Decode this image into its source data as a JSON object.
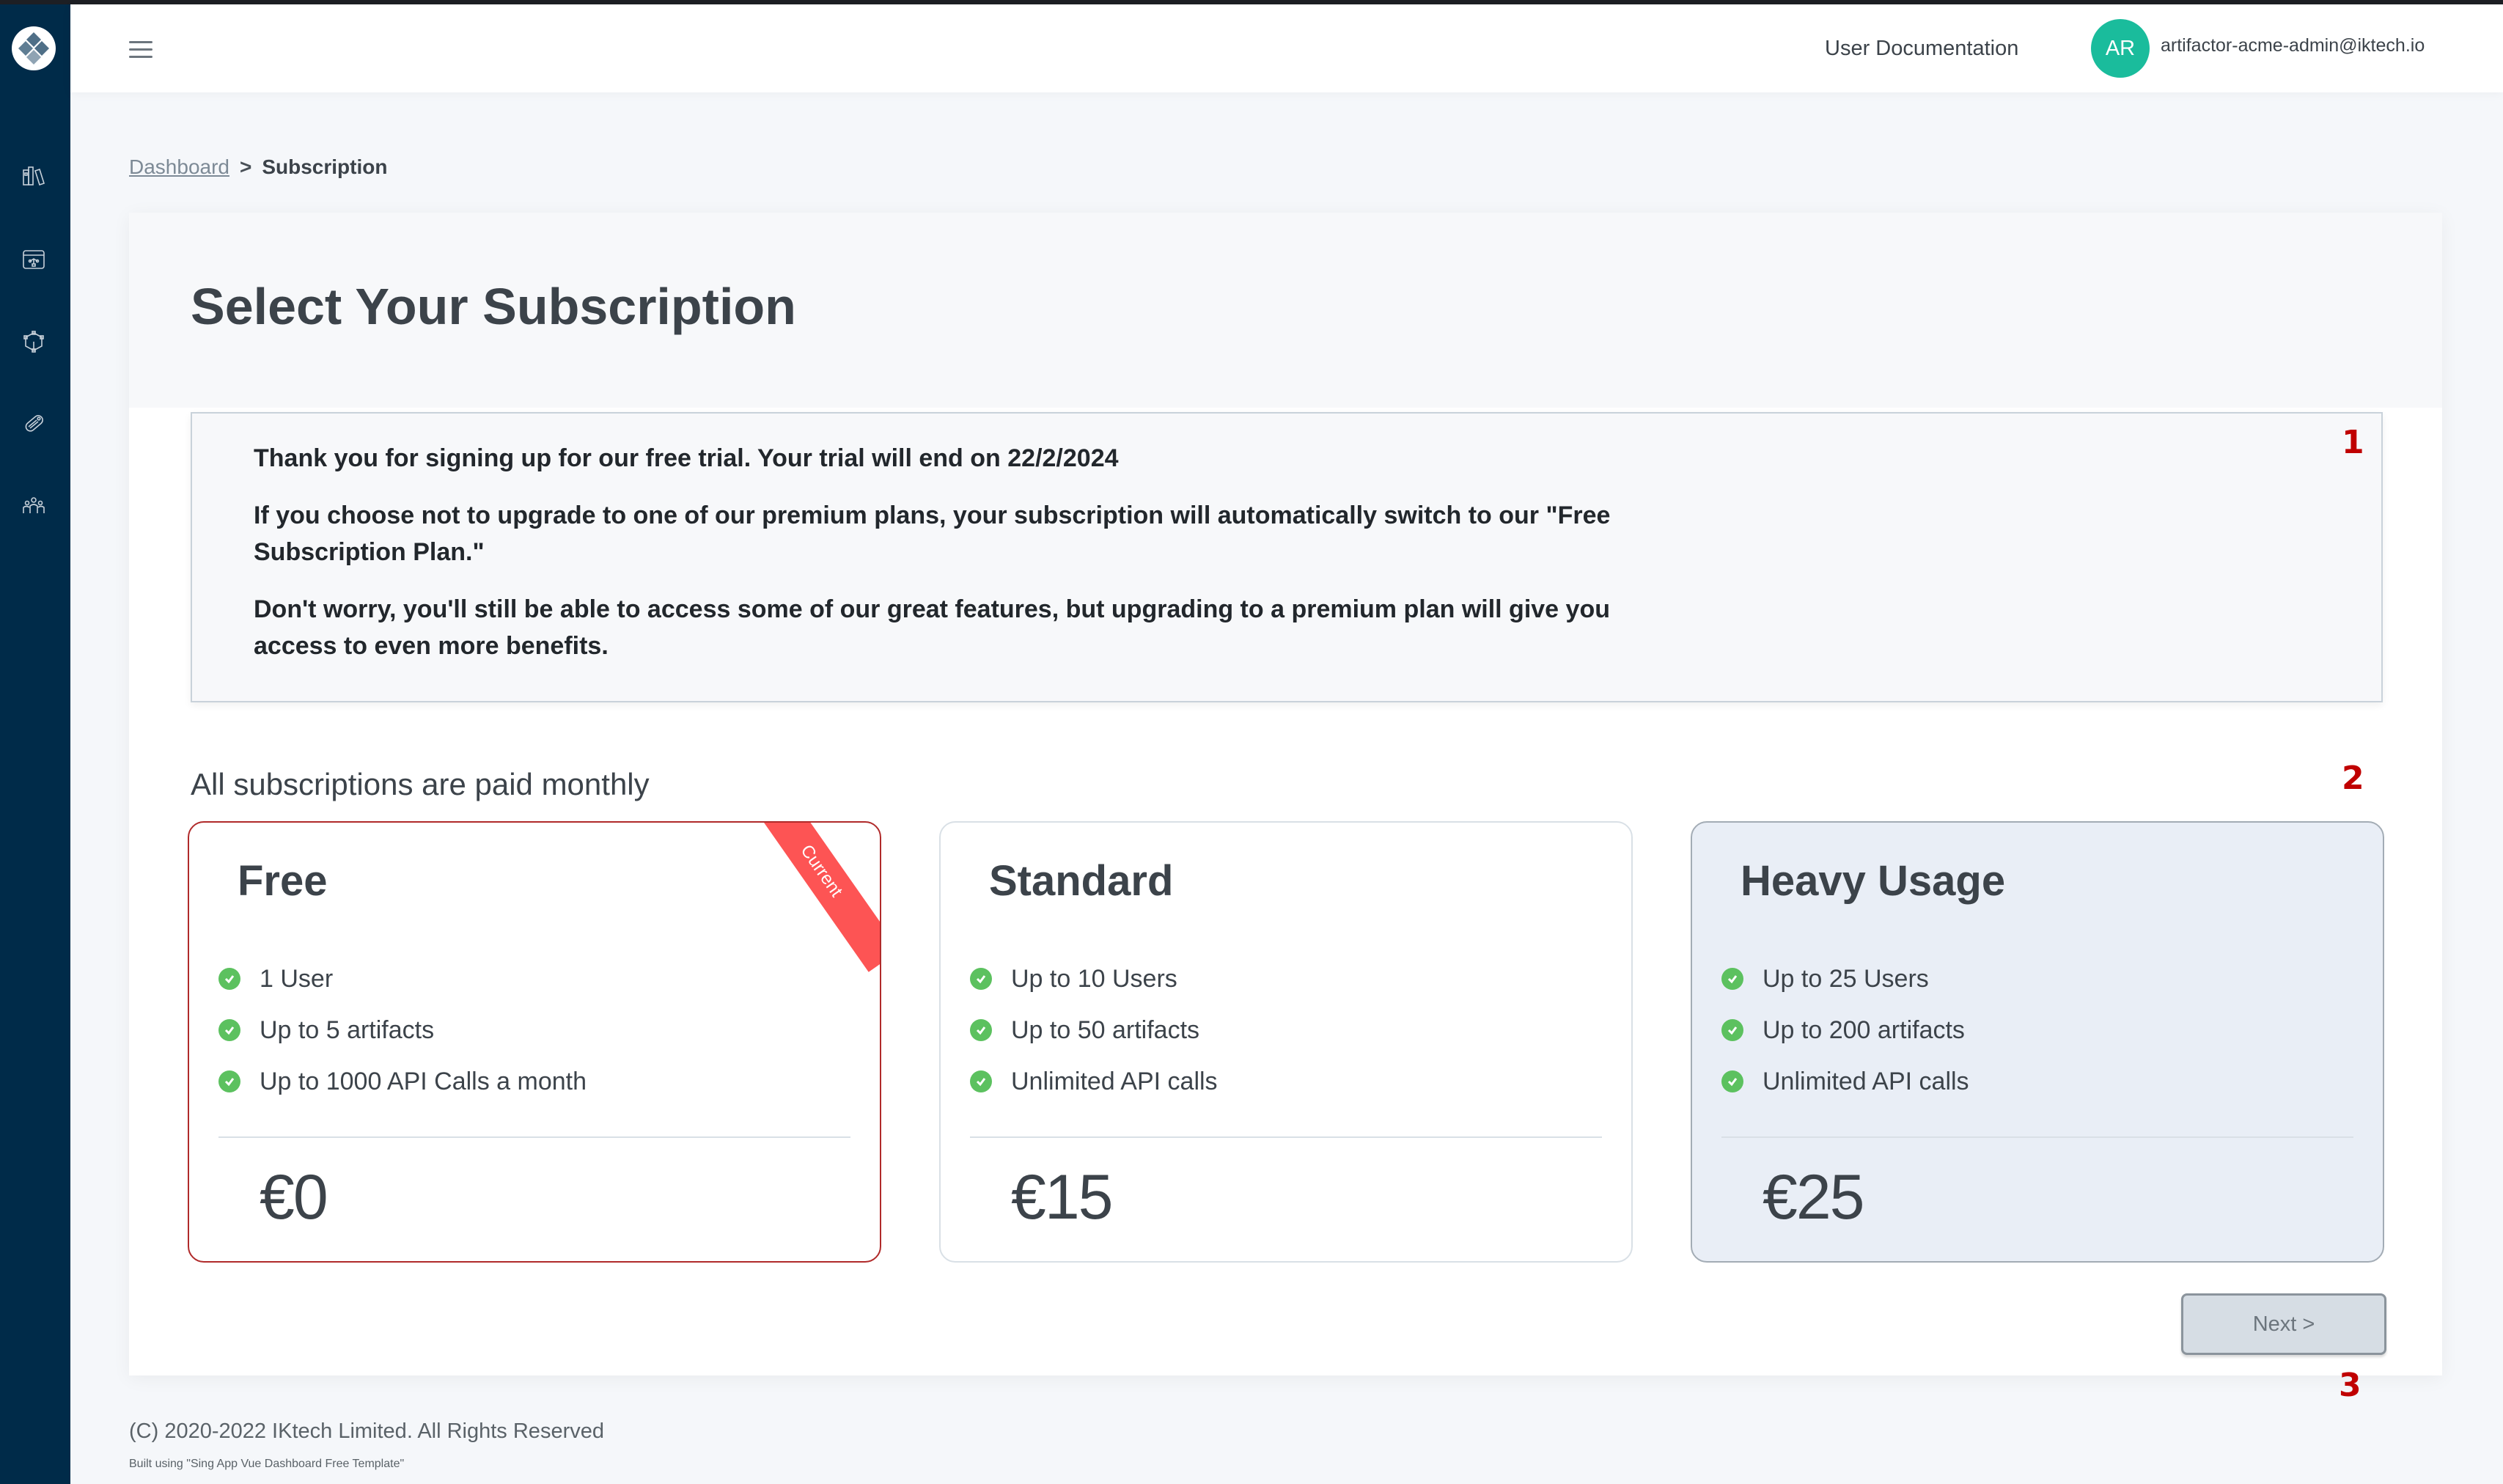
{
  "app": {
    "logo": "diamond-logo",
    "sidebar_items": [
      {
        "name": "library",
        "icon": "books-icon"
      },
      {
        "name": "workflows",
        "icon": "browser-flow-icon"
      },
      {
        "name": "models",
        "icon": "network-cube-icon"
      },
      {
        "name": "tags",
        "icon": "tag-icon"
      },
      {
        "name": "team",
        "icon": "users-icon"
      }
    ]
  },
  "header": {
    "menu_icon": "hamburger-icon",
    "docs_link": "User Documentation",
    "avatar_initials": "AR",
    "user_email": "artifactor-acme-admin@iktech.io"
  },
  "breadcrumb": {
    "parent": "Dashboard",
    "separator": ">",
    "current": "Subscription"
  },
  "page": {
    "title": "Select Your Subscription",
    "notice": [
      "Thank you for signing up for our free trial. Your trial will end on 22/2/2024",
      "If you choose not to upgrade to one of our premium plans, your subscription will automatically switch to our \"Free Subscription Plan.\"",
      "Don't worry, you'll still be able to access some of our great features, but upgrading to a premium plan will give you access to even more benefits."
    ],
    "paid_note": "All subscriptions are paid monthly",
    "plans": [
      {
        "name": "Free",
        "ribbon": "Current",
        "features": [
          "1 User",
          "Up to 5 artifacts",
          "Up to 1000 API Calls a month"
        ],
        "price": "€0"
      },
      {
        "name": "Standard",
        "features": [
          "Up to 10 Users",
          "Up to 50 artifacts",
          "Unlimited API calls"
        ],
        "price": "€15"
      },
      {
        "name": "Heavy Usage",
        "features": [
          "Up to 25 Users",
          "Up to 200 artifacts",
          "Unlimited API calls"
        ],
        "price": "€25"
      }
    ],
    "next_button": "Next >",
    "annotations": [
      "1",
      "2",
      "3"
    ]
  },
  "footer": {
    "copyright": "(C) 2020-2022 IKtech Limited. All Rights Reserved",
    "built_with": "Built using \"Sing App Vue Dashboard Free Template\""
  },
  "colors": {
    "sidebar": "#002b49",
    "avatar": "#1abc9c",
    "ribbon": "#fd5454",
    "check": "#5cc15f",
    "annotation": "#c00000"
  }
}
